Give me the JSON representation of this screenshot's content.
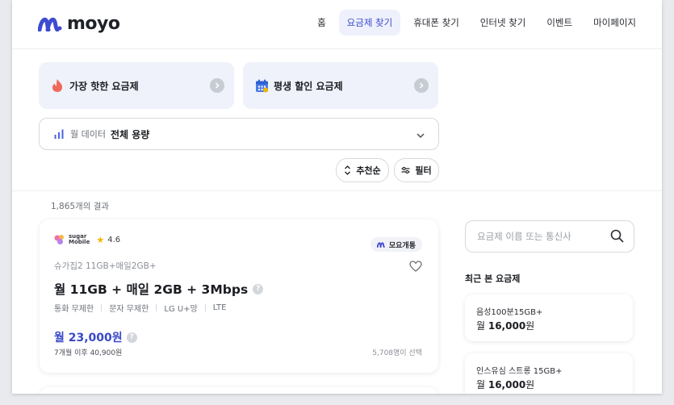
{
  "header": {
    "logo": "moyo",
    "nav": [
      "홈",
      "요금제 찾기",
      "휴대폰 찾기",
      "인터넷 찾기",
      "이벤트",
      "마이페이지"
    ],
    "active_nav": "요금제 찾기"
  },
  "promos": [
    {
      "label": "가장 핫한 요금제",
      "icon": "fire-icon"
    },
    {
      "label": "평생 할인 요금제",
      "icon": "calendar-icon"
    }
  ],
  "data_filter": {
    "label": "월 데이터",
    "value": "전체 용량"
  },
  "sort": {
    "label": "추천순"
  },
  "filter": {
    "label": "필터"
  },
  "results": {
    "count": "1,865개의 결과"
  },
  "plan": {
    "brand_line1": "sugar",
    "brand_line2": "Mobile",
    "rating": "4.6",
    "badge": "모요개통",
    "sub_name": "슈가집2 11GB+매일2GB+",
    "title": "월 11GB + 매일 2GB + 3Mbps",
    "features": [
      "통화 무제한",
      "문자 무제한",
      "LG U+망",
      "LTE"
    ],
    "price": "월 23,000원",
    "after_price": "7개월 이후 40,900원",
    "chosen": "5,708명이 선택"
  },
  "search": {
    "placeholder": "요금제 이름 또는 통신사"
  },
  "recent": {
    "title": "최근 본 요금제",
    "items": [
      {
        "name": "음성100분15GB+",
        "price_prefix": "월 ",
        "price": "16,000",
        "price_suffix": "원"
      },
      {
        "name": "인스유심 스트롱 15GB+",
        "price_prefix": "월 ",
        "price": "16,000",
        "price_suffix": "원"
      }
    ]
  },
  "colors": {
    "accent": "#3e4bd1",
    "price": "#3949c6",
    "promo_bg": "#eff2fb"
  }
}
